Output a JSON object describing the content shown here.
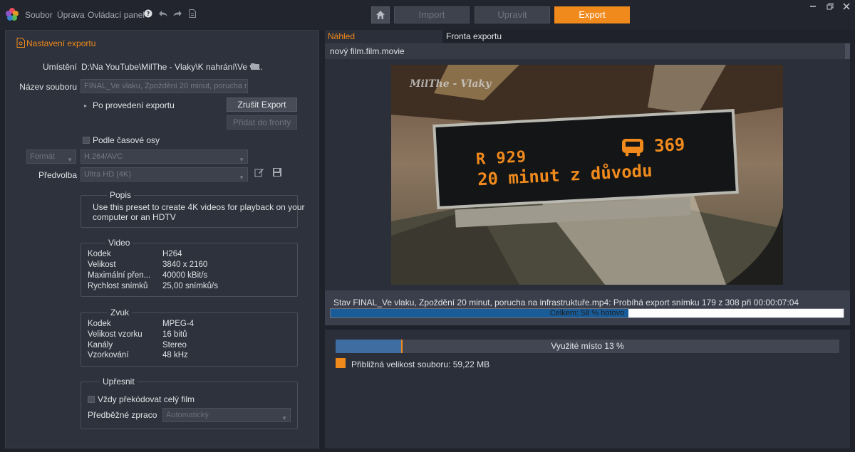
{
  "menu": {
    "file": "Soubor",
    "edit": "Úprava",
    "control": "Ovládací panel"
  },
  "toolbar": {
    "help_icon": "help-icon",
    "undo_icon": "undo-icon",
    "redo_icon": "redo-icon",
    "doc_icon": "document-icon"
  },
  "tabs": {
    "import": "Import",
    "edit": "Upravit",
    "export": "Export"
  },
  "left": {
    "section_title": "Nastavení exportu",
    "location_label": "Umístění",
    "location_value": "D:\\Na YouTube\\MilThe - Vlaky\\K nahrání\\Ve vl...",
    "filename_label": "Název souboru",
    "filename_value": "FINAL_Ve vlaku, Zpoždění 20 minut, porucha r",
    "after_export": "Po provedení exportu",
    "cancel_export": "Zrušit Export",
    "add_queue": "Přidat do fronty",
    "timeline_check": "Podle časové osy",
    "format_label": "Formát",
    "format_value": "H.264/AVC",
    "preset_label": "Předvolba",
    "preset_value": "Ultra HD (4K)",
    "desc_title": "Popis",
    "desc_text_1": "Use this preset to create 4K videos for playback on your",
    "desc_text_2": "computer or an HDTV",
    "video_title": "Video",
    "video": [
      {
        "k": "Kodek",
        "v": "H264"
      },
      {
        "k": "Velikost",
        "v": "3840 x 2160"
      },
      {
        "k": "Maximální přen...",
        "v": "40000 kBit/s"
      },
      {
        "k": "Rychlost snímků",
        "v": "25,00 snímků/s"
      }
    ],
    "audio_title": "Zvuk",
    "audio": [
      {
        "k": "Kodek",
        "v": "MPEG-4"
      },
      {
        "k": "Velikost vzorku",
        "v": "16 bitů"
      },
      {
        "k": "Kanály",
        "v": "Stereo"
      },
      {
        "k": "Vzorkování",
        "v": "48 kHz"
      }
    ],
    "refine_title": "Upřesnit",
    "always_transcode": "Vždy překódovat celý film",
    "prerender_label": "Předběžné zpraco",
    "prerender_value": "Automatický"
  },
  "right": {
    "preview_tab": "Náhled",
    "queue_tab": "Fronta exportu",
    "filename": "nový film.film.movie",
    "video_overlay_1": "R 929",
    "video_overlay_2": "369",
    "video_overlay_3": "20 minut z důvodu",
    "watermark": "MilThe - Vlaky",
    "status": "Stav FINAL_Ve vlaku, Zpoždění 20 minut, porucha na infrastruktuře.mp4: Probíhá export snímku 179 z 308 při 00:00:07:04",
    "progress_text": "Celkem: 58 % hotovo",
    "progress_fraction": 0.58,
    "space_text": "Využité místo 13 %",
    "space_fraction": 0.13,
    "size_text": "Přibližná velikost souboru: 59,22 MB"
  },
  "colors": {
    "accent": "#f08a1c",
    "progress": "#1a5c98"
  }
}
